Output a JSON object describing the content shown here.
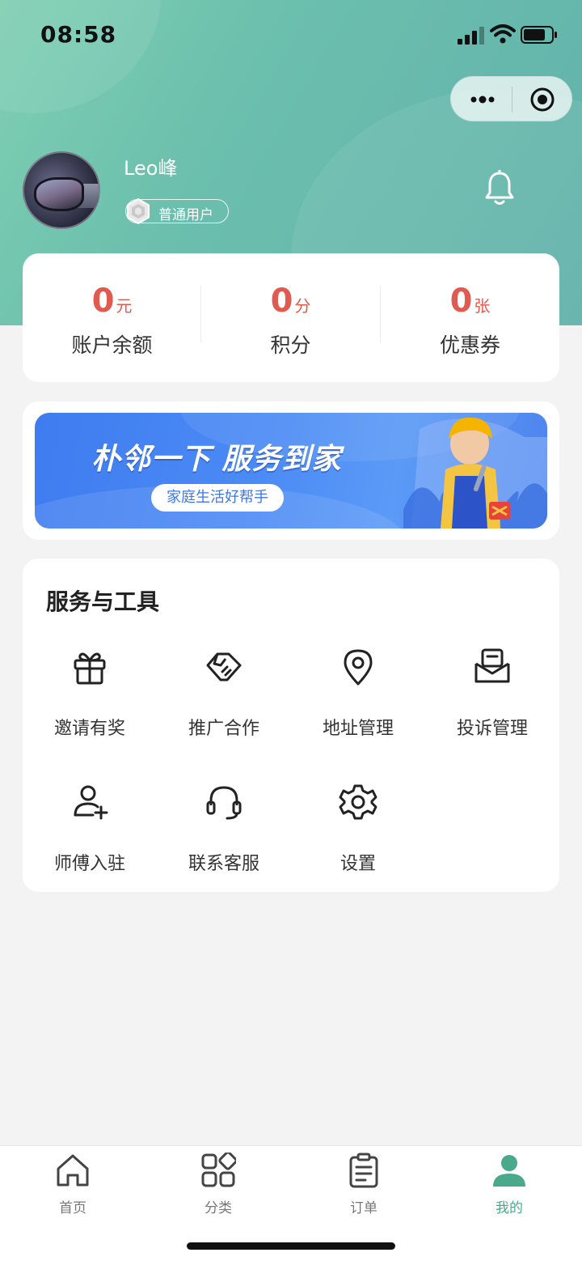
{
  "status_bar": {
    "time": "08:58"
  },
  "capsule": {
    "more_icon": "more-dots-icon",
    "close_icon": "target-circle-icon"
  },
  "user": {
    "name": "Leo峰",
    "level": "普通用户",
    "notification_icon": "bell-icon"
  },
  "stats": [
    {
      "value": "0",
      "unit": "元",
      "label": "账户余额"
    },
    {
      "value": "0",
      "unit": "分",
      "label": "积分"
    },
    {
      "value": "0",
      "unit": "张",
      "label": "优惠券"
    }
  ],
  "banner": {
    "title": "朴邻一下 服务到家",
    "subtitle": "家庭生活好帮手"
  },
  "tools": {
    "title": "服务与工具",
    "items": [
      {
        "label": "邀请有奖",
        "icon": "gift-icon"
      },
      {
        "label": "推广合作",
        "icon": "handshake-icon"
      },
      {
        "label": "地址管理",
        "icon": "location-pin-icon"
      },
      {
        "label": "投诉管理",
        "icon": "mail-icon"
      },
      {
        "label": "师傅入驻",
        "icon": "add-user-icon"
      },
      {
        "label": "联系客服",
        "icon": "headset-icon"
      },
      {
        "label": "设置",
        "icon": "gear-icon"
      }
    ]
  },
  "tabbar": {
    "items": [
      {
        "label": "首页",
        "icon": "home-icon",
        "active": false
      },
      {
        "label": "分类",
        "icon": "category-icon",
        "active": false
      },
      {
        "label": "订单",
        "icon": "order-icon",
        "active": false
      },
      {
        "label": "我的",
        "icon": "profile-icon",
        "active": true
      }
    ]
  },
  "colors": {
    "accent": "#4aa98a",
    "value_red": "#e05a50",
    "header_green": "#6cc0ad",
    "banner_blue": "#4b8bf5"
  }
}
